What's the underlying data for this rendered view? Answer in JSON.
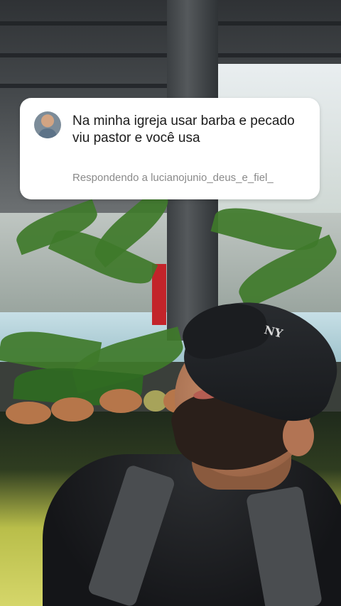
{
  "comment_bubble": {
    "avatar": "user-avatar",
    "text": "Na minha igreja usar barba e pecado viu pastor e você usa",
    "reply_info": "Respondendo a lucianojunio_deus_e_fiel_"
  },
  "background": {
    "cap_logo": "NY"
  },
  "colors": {
    "bubble_background": "#ffffff",
    "comment_text": "#1b1b1b",
    "reply_text": "#8a8a8a"
  }
}
